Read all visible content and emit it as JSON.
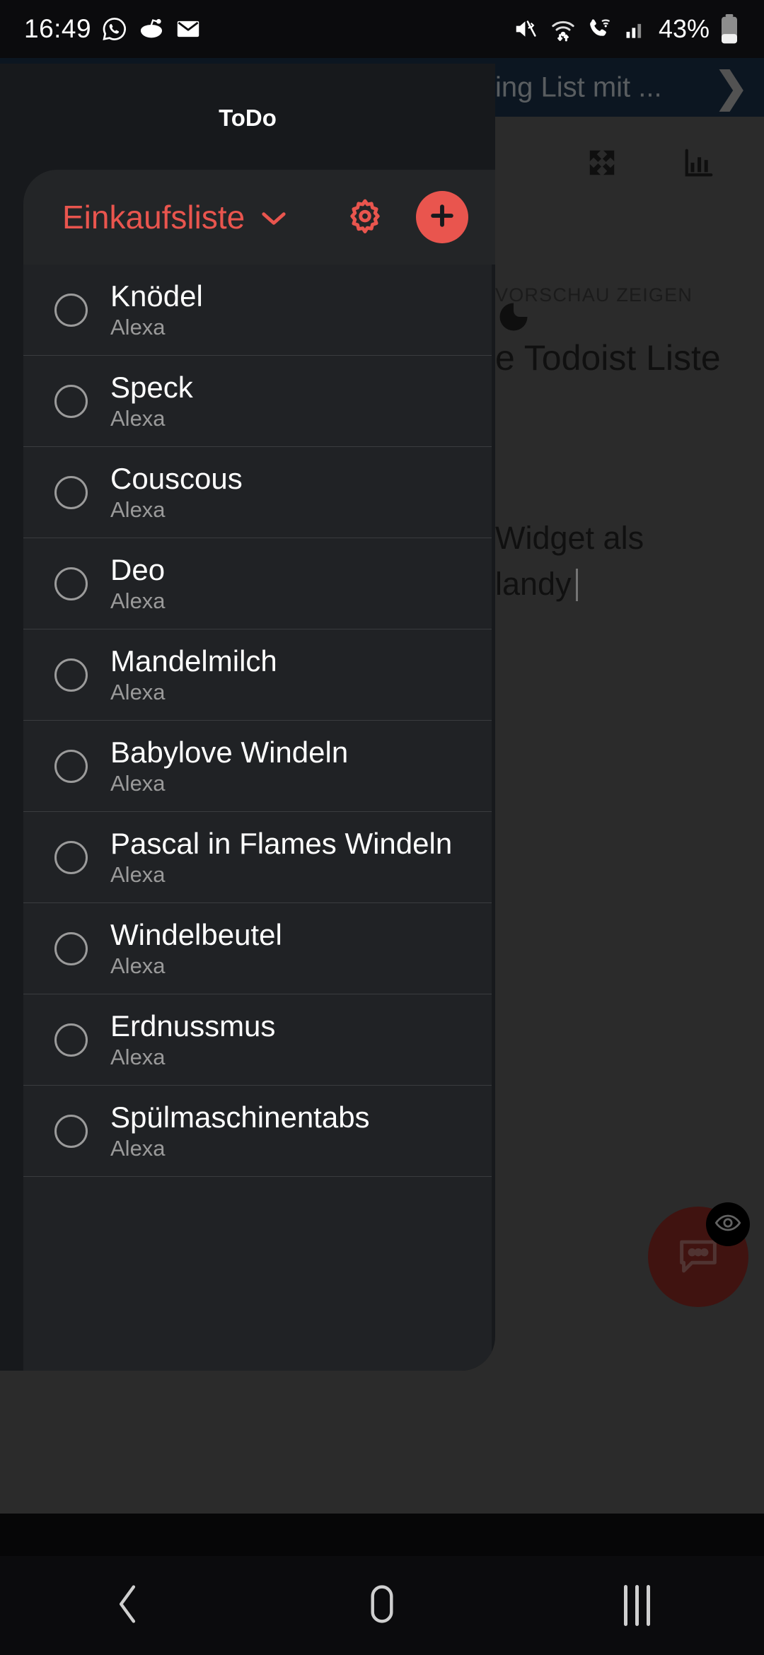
{
  "status_bar": {
    "time": "16:49",
    "left_icons": [
      "whatsapp-icon",
      "reddit-icon",
      "mail-icon"
    ],
    "right_icons": [
      "mute-vibrate-icon",
      "wifi-transfer-icon",
      "wifi-calling-icon",
      "signal-bars-icon"
    ],
    "battery_percent": "43%"
  },
  "background_app": {
    "appbar_title": "ing List mit ...",
    "next_chevron": "❯",
    "toolbar_icons": [
      "chevron-right-icon",
      "expand-icon",
      "chart-icon"
    ],
    "show_preview_label": "VORSCHAU ZEIGEN",
    "heading": "e Todoist Liste",
    "body_line1": "Widget als",
    "body_line2": "landy",
    "fab_icon": "chat-bubble-icon",
    "fab_badge_icon": "eye-icon"
  },
  "widget": {
    "title": "ToDo",
    "list_name": "Einkaufsliste",
    "dropdown_icon": "chevron-down-icon",
    "settings_icon": "gear-icon",
    "add_icon": "plus-icon",
    "accent_color": "#e9554e",
    "panel_color": "#17191c",
    "list_color": "#202225",
    "items": [
      {
        "title": "Knödel",
        "subtitle": "Alexa",
        "checked": false
      },
      {
        "title": "Speck",
        "subtitle": "Alexa",
        "checked": false
      },
      {
        "title": "Couscous",
        "subtitle": "Alexa",
        "checked": false
      },
      {
        "title": "Deo",
        "subtitle": "Alexa",
        "checked": false
      },
      {
        "title": "Mandelmilch",
        "subtitle": "Alexa",
        "checked": false
      },
      {
        "title": "Babylove Windeln",
        "subtitle": "Alexa",
        "checked": false
      },
      {
        "title": "Pascal in Flames Windeln",
        "subtitle": "Alexa",
        "checked": false
      },
      {
        "title": "Windelbeutel",
        "subtitle": "Alexa",
        "checked": false
      },
      {
        "title": "Erdnussmus",
        "subtitle": "Alexa",
        "checked": false
      },
      {
        "title": "Spülmaschinentabs",
        "subtitle": "Alexa",
        "checked": false
      }
    ]
  },
  "nav_bar": {
    "back_icon": "back-chevron-icon",
    "home_icon": "home-circle-icon",
    "recents_icon": "recents-bars-icon"
  }
}
